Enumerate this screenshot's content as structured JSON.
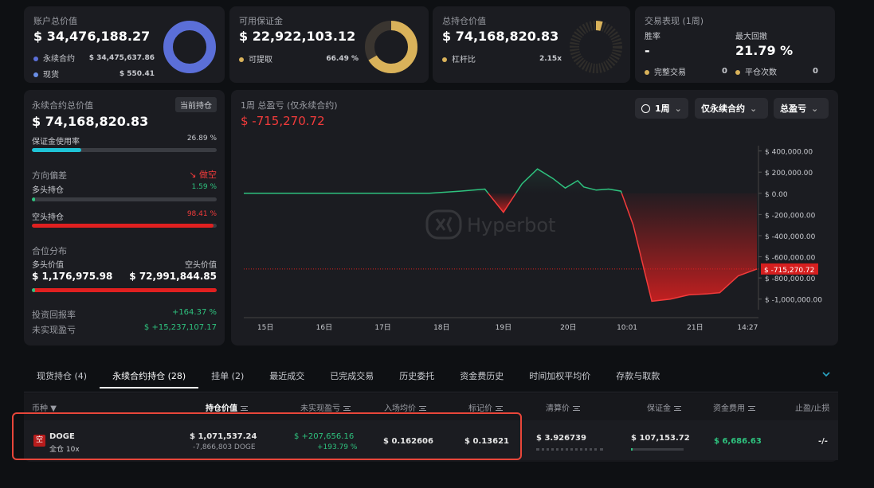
{
  "summary": {
    "account_total": {
      "label": "账户总价值",
      "value": "$ 34,476,188.27",
      "items": [
        {
          "label": "永续合约",
          "value": "$ 34,475,637.86",
          "color": "#5b6fd8"
        },
        {
          "label": "现货",
          "value": "$ 550.41",
          "color": "#6a8fe6"
        }
      ]
    },
    "available_margin": {
      "label": "可用保证金",
      "value": "$ 22,922,103.12",
      "item_label": "可提取",
      "item_value": "66.49 %",
      "color": "#d9b25a"
    },
    "total_position": {
      "label": "总持仓价值",
      "value": "$ 74,168,820.83",
      "item_label": "杠杆比",
      "item_value": "2.15x",
      "color": "#d9b25a"
    },
    "performance": {
      "label": "交易表现 (1周)",
      "winrate_label": "胜率",
      "winrate_value": "-",
      "drawdown_label": "最大回撤",
      "drawdown_value": "21.79 %",
      "completed_label": "完整交易",
      "completed_value": "0",
      "close_label": "平仓次数",
      "close_value": "0",
      "color": "#d9b25a"
    }
  },
  "perp": {
    "title": "永续合约总价值",
    "badge": "当前持仓",
    "value": "$ 74,168,820.83",
    "margin_usage_label": "保证金使用率",
    "margin_usage_value": "26.89 %",
    "margin_usage_pct": 26.89,
    "direction_label": "方向偏差",
    "direction_value": "做空",
    "long_label": "多头持仓",
    "long_value": "1.59 %",
    "long_pct": 1.59,
    "short_label": "空头持仓",
    "short_value": "98.41 %",
    "short_pct": 98.41,
    "dist_label": "合位分布",
    "long_val_label": "多头价值",
    "short_val_label": "空头价值",
    "long_val": "$ 1,176,975.98",
    "short_val": "$ 72,991,844.85",
    "roi_label": "投资回报率",
    "roi_value": "+164.37 %",
    "upnl_label": "未实现盈亏",
    "upnl_value": "$ +15,237,107.17"
  },
  "pnl_chart": {
    "title": "1周 总盈亏 (仅永续合约)",
    "value": "$ -715,270.72",
    "period_label": "1周",
    "scope_label": "仅永续合约",
    "metric_label": "总盈亏",
    "watermark": "Hyperbot"
  },
  "chart_data": {
    "type": "area",
    "title": "1周 总盈亏 (仅永续合约)",
    "x_ticks": [
      "15日",
      "16日",
      "17日",
      "18日",
      "19日",
      "20日",
      "10:01",
      "21日",
      "14:27"
    ],
    "y_ticks": [
      "$ 400,000.00",
      "$ 200,000.00",
      "$ 0.00",
      "$ -200,000.00",
      "$ -400,000.00",
      "$ -600,000.00",
      "$ -800,000.00",
      "$ -1,000,000.00"
    ],
    "ylim": [
      -1100000,
      450000
    ],
    "current_label": "$ -715,270.72",
    "current_value": -715270.72,
    "x_range": [
      0,
      8.3
    ],
    "series": [
      {
        "x": [
          0,
          1,
          2,
          3,
          3.5,
          3.9,
          4.2,
          4.5,
          4.75,
          5.0,
          5.2,
          5.4,
          5.5,
          5.7,
          5.9,
          6.1,
          6.3,
          6.6,
          6.9,
          7.2,
          7.5,
          7.7,
          8.0,
          8.3
        ],
        "y": [
          0,
          0,
          0,
          0,
          20000,
          40000,
          -180000,
          90000,
          230000,
          140000,
          50000,
          120000,
          60000,
          30000,
          40000,
          20000,
          -300000,
          -1020000,
          -1000000,
          -960000,
          -950000,
          -940000,
          -780000,
          -715270
        ],
        "positive_color": "#2ec27e",
        "negative_color": "#f23b3b"
      }
    ]
  },
  "tabs": [
    {
      "label": "现货持仓 (4)",
      "active": false
    },
    {
      "label": "永续合约持仓 (28)",
      "active": true
    },
    {
      "label": "挂单 (2)",
      "active": false
    },
    {
      "label": "最近成交",
      "active": false
    },
    {
      "label": "已完成交易",
      "active": false
    },
    {
      "label": "历史委托",
      "active": false
    },
    {
      "label": "资金费历史",
      "active": false
    },
    {
      "label": "时间加权平均价",
      "active": false
    },
    {
      "label": "存款与取款",
      "active": false
    }
  ],
  "table": {
    "headers": {
      "coin": "币种",
      "value": "持仓价值",
      "upnl": "未实现盈亏",
      "entry": "入场均价",
      "mark": "标记价",
      "liq": "清算价",
      "margin": "保证金",
      "funding": "资金费用",
      "tpsl": "止盈/止损"
    },
    "row": {
      "badge": "空",
      "coin": "DOGE",
      "mode": "全仓 10x",
      "value": "$ 1,071,537.24",
      "qty": "-7,866,803 DOGE",
      "upnl": "$ +207,656.16",
      "upnl_pct": "+193.79 %",
      "entry": "$ 0.162606",
      "mark": "$ 0.13621",
      "liq": "$ 3.926739",
      "margin": "$ 107,153.72",
      "funding": "$ 6,686.63",
      "tpsl": "-/-"
    }
  }
}
